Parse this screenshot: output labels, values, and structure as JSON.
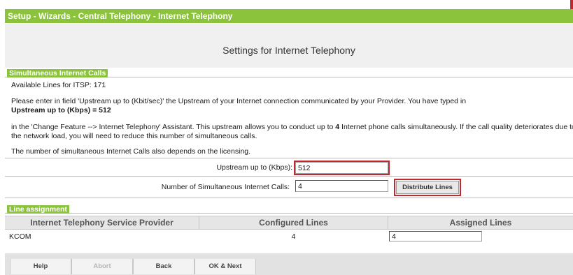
{
  "breadcrumb": "Setup - Wizards - Central Telephony - Internet Telephony",
  "page_title": "Settings for Internet Telephony",
  "simultaneous_section": {
    "title": "Simultaneous Internet Calls",
    "available_lines": "Available Lines for ITSP: 171",
    "instruction": "Please enter in field 'Upstream up to (Kbit/sec)' the Upstream of your Internet connection communicated by your Provider. You have typed in",
    "upstream_value_text": "Upstream up to (Kbps) = 512",
    "assistant_text_a": "in the 'Change Feature --> Internet Telephony' Assistant. This upstream allows you to conduct up to",
    "assistant_calls": "4",
    "assistant_text_b": "Internet phone calls simultaneously. If the call quality deteriorates due to",
    "assistant_text_line2": "the network load, you will need to reduce this number of simultaneous calls.",
    "licensing_note": "The number of simultaneous Internet Calls also depends on the licensing."
  },
  "form": {
    "upstream_label": "Upstream up to (Kbps):",
    "upstream_value": "512",
    "calls_label": "Number of Simultaneous Internet Calls:",
    "calls_value": "4",
    "distribute_button": "Distribute Lines"
  },
  "line_assignment": {
    "title": "Line assignment",
    "columns": [
      "Internet Telephony Service Provider",
      "Configured Lines",
      "Assigned Lines"
    ],
    "rows": [
      {
        "provider": "KCOM",
        "configured": "4",
        "assigned": "4"
      }
    ]
  },
  "footer": {
    "help": "Help",
    "abort": "Abort",
    "back": "Back",
    "ok_next": "OK & Next"
  },
  "colors": {
    "accent_green": "#8bc43c",
    "highlight_red": "#c0282d"
  }
}
